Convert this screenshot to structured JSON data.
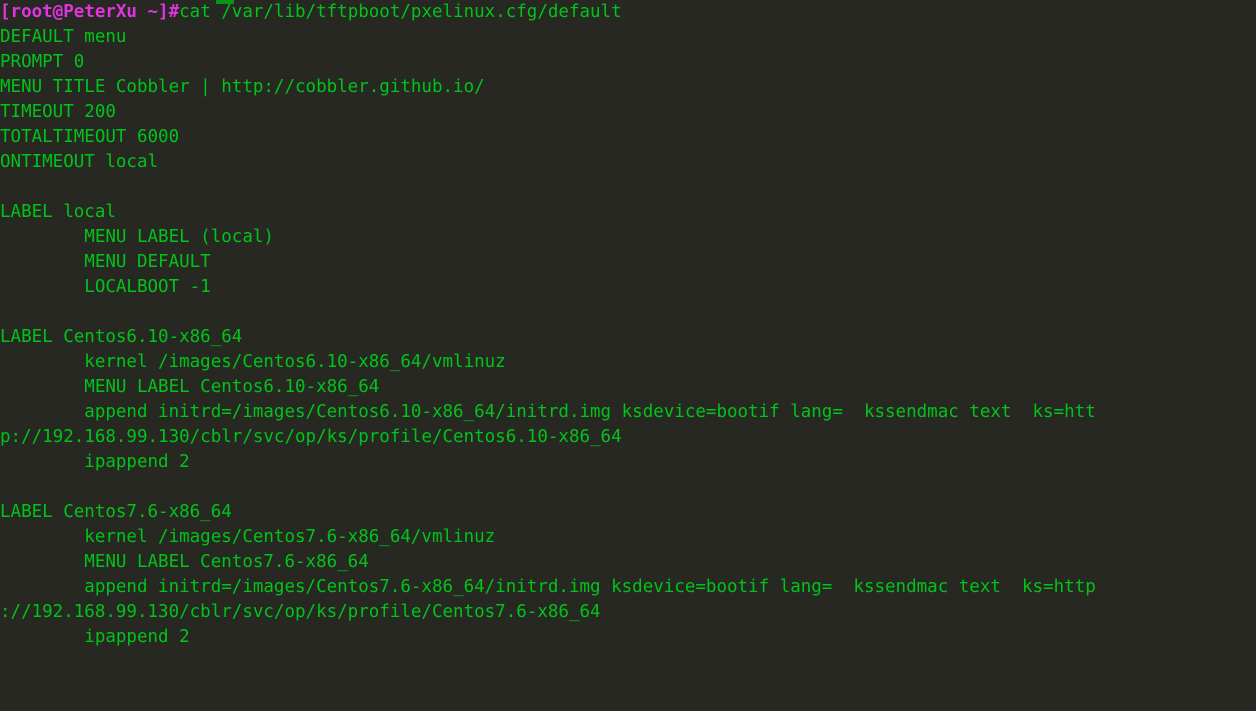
{
  "terminal": {
    "title": "root@PeterXu:~",
    "background_color": "#272822",
    "foreground_color": "#00c419",
    "prompt_color": "#e034e0",
    "columns": 104,
    "rows": 28,
    "font_size_px": 17.5,
    "line_height_px": 25
  },
  "prompt": {
    "text": "[root@PeterXu ~]#",
    "user": "root",
    "host": "PeterXu",
    "cwd": "~",
    "symbol": "#"
  },
  "command": {
    "text": "cat /var/lib/tftpboot/pxelinux.cfg/default",
    "program": "cat",
    "argument": "/var/lib/tftpboot/pxelinux.cfg/default"
  },
  "output_lines": [
    "DEFAULT menu",
    "PROMPT 0",
    "MENU TITLE Cobbler | http://cobbler.github.io/",
    "TIMEOUT 200",
    "TOTALTIMEOUT 6000",
    "ONTIMEOUT local",
    "",
    "LABEL local",
    "        MENU LABEL (local)",
    "        MENU DEFAULT",
    "        LOCALBOOT -1",
    "",
    "LABEL Centos6.10-x86_64",
    "        kernel /images/Centos6.10-x86_64/vmlinuz",
    "        MENU LABEL Centos6.10-x86_64",
    "        append initrd=/images/Centos6.10-x86_64/initrd.img ksdevice=bootif lang=  kssendmac text  ks=htt",
    "p://192.168.99.130/cblr/svc/op/ks/profile/Centos6.10-x86_64",
    "        ipappend 2",
    "",
    "LABEL Centos7.6-x86_64",
    "        kernel /images/Centos7.6-x86_64/vmlinuz",
    "        MENU LABEL Centos7.6-x86_64",
    "        append initrd=/images/Centos7.6-x86_64/initrd.img ksdevice=bootif lang=  kssendmac text  ks=http",
    "://192.168.99.130/cblr/svc/op/ks/profile/Centos7.6-x86_64",
    "        ipappend 2"
  ]
}
